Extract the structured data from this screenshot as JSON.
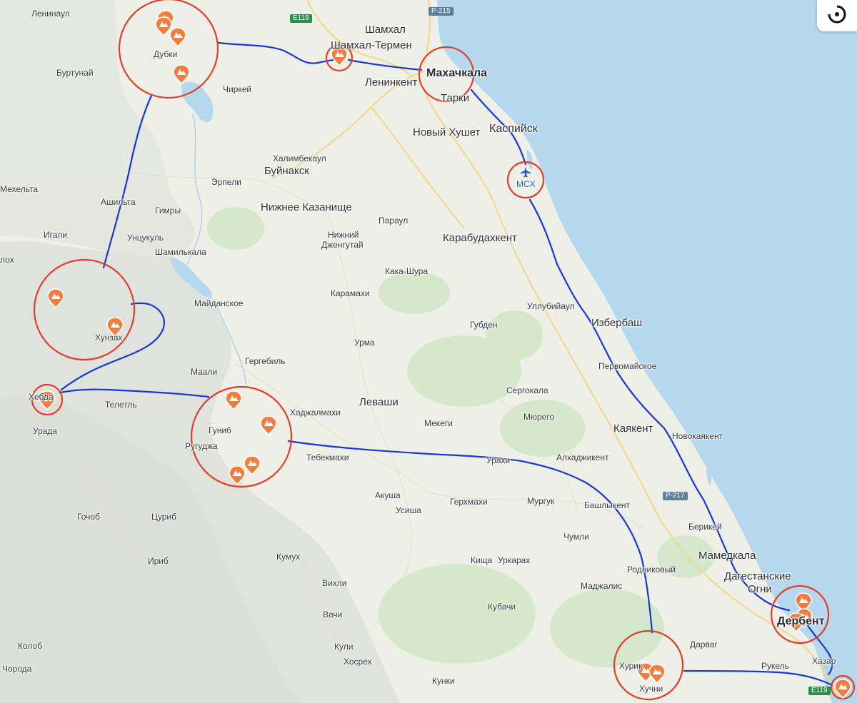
{
  "map": {
    "colors": {
      "water": "#b5d8ee",
      "land": "#eef0e8",
      "route": "#1637d9",
      "circle": "#e23d28",
      "pin": "#f27d3d",
      "airport": "#2659c9"
    },
    "airport_icon": "airplane-icon",
    "pin_icon": "mountain-pin-icon",
    "control_icon": "alice-assistant-icon",
    "road_shields": [
      {
        "label": "E119",
        "kind": "green"
      },
      {
        "label": "Р-215",
        "kind": "blue"
      },
      {
        "label": "Р-217",
        "kind": "blue"
      },
      {
        "label": "E119",
        "kind": "green"
      }
    ],
    "places": {
      "leninaul": "Ленинаул",
      "burtunay": "Буртунай",
      "dubki": "Дубки",
      "chirkey": "Чиркей",
      "shamkhal": "Шамхал",
      "shamkhal_termen": "Шамхал-Термен",
      "makhachkala": "Махачкала",
      "leninkent": "Ленинкент",
      "tarki": "Тарки",
      "novy_khushet": "Новый Хушет",
      "kaspiysk": "Каспийск",
      "airport_code": "MCX",
      "khalimbekaul": "Халимбекаул",
      "buynaksk": "Буйнакск",
      "erpeli": "Эрпели",
      "mekhelta": "Мехельта",
      "ashilta": "Ашильта",
      "gimry": "Гимры",
      "nizhnee_kazanische": "Нижнее Казанище",
      "paraul": "Параул",
      "igali": "Игали",
      "untsukul": "Унцукуль",
      "nizhny": "Нижний",
      "dzhengutay": "Дженгутай",
      "karabudakhkent": "Карабудахкент",
      "shamilkala": "Шамилькала",
      "lokh": "лох",
      "kaka_shura": "Кака-Шура",
      "karamakhi": "Карамахи",
      "maydanskoe": "Майданское",
      "ullubiyaul": "Уллубийаул",
      "izberbash": "Избербаш",
      "gubden": "Губден",
      "khunzakh": "Хунзах",
      "urma": "Урма",
      "gergebil": "Гергебиль",
      "pervomayskoe": "Первомайское",
      "maali": "Маали",
      "sergokala": "Сергокала",
      "khebda": "Хебда",
      "teletl": "Телетль",
      "levashi": "Леваши",
      "khadzhalmakhi": "Хаджалмахи",
      "myurego": "Мюрего",
      "mekegi": "Мекеги",
      "kayakent": "Каякент",
      "novokayakent": "Новокаякент",
      "urada": "Урада",
      "gunib": "Гуниб",
      "rugudzha": "Ругуджа",
      "tebekmakhi": "Тебекмахи",
      "urakhi": "Урахи",
      "alkhadzhikent": "Алхаджикент",
      "akusha": "Акуша",
      "usisha": "Усиша",
      "gerkhmakhi": "Герхмахи",
      "murguk": "Мургук",
      "bashlykent": "Башлыкент",
      "gochob": "Гочоб",
      "tsurib": "Цуриб",
      "berikey": "Берикей",
      "chumli": "Чумли",
      "kumukh": "Кумух",
      "mamedkala": "Мамедкала",
      "irib": "Ириб",
      "kishcha": "Кища",
      "urkarakh": "Уркарах",
      "rodnikovy": "Родниковый",
      "dagestanskie": "Дагестанские",
      "ogni": "Огни",
      "vikhli": "Вихли",
      "madzhalis": "Маджалис",
      "kubachi": "Кубачи",
      "vachi": "Вачи",
      "derbent": "Дербент",
      "kolob": "Колоб",
      "darvag": "Дарваг",
      "kuli": "Кули",
      "khazar": "Хазар",
      "khosrekh": "Хосрех",
      "khuryuk": "Хурик",
      "rukel": "Рукель",
      "chorod": "Чорода",
      "khuchni": "Хучни",
      "kunki": "Кунки"
    }
  }
}
